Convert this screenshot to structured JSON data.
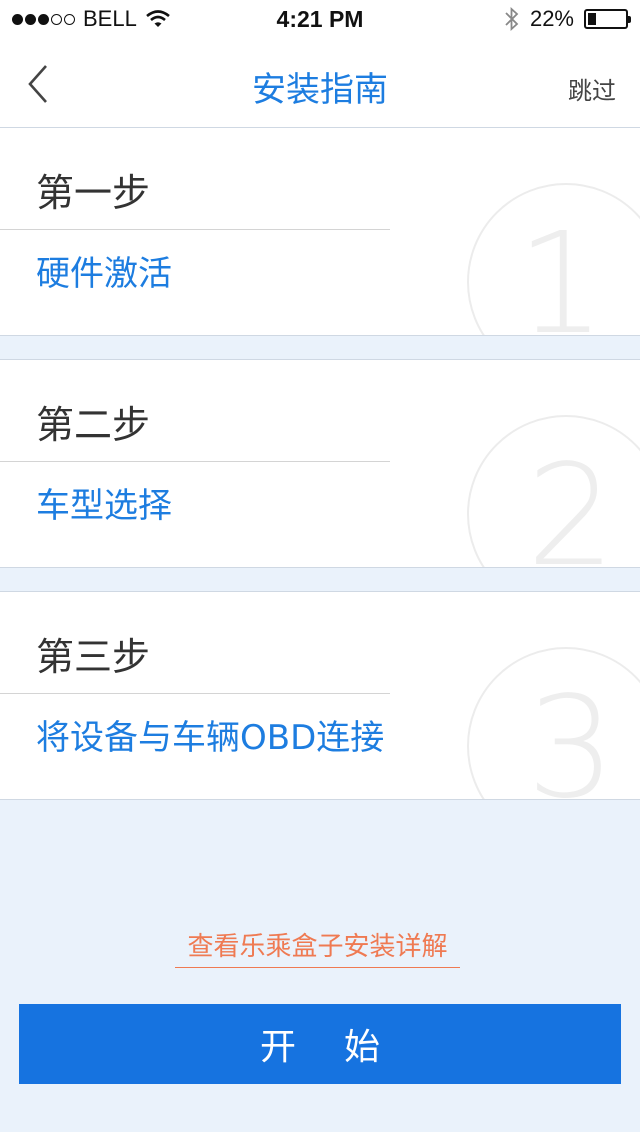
{
  "status_bar": {
    "carrier": "BELL",
    "time": "4:21 PM",
    "battery_percent_text": "22%",
    "battery_level": 0.22,
    "signal_bars": 3
  },
  "nav": {
    "title": "安装指南",
    "skip_label": "跳过"
  },
  "steps": [
    {
      "title": "第一步",
      "description": "硬件激活",
      "watermark_number": "1"
    },
    {
      "title": "第二步",
      "description": "车型选择",
      "watermark_number": "2"
    },
    {
      "title": "第三步",
      "description": "将设备与车辆OBD连接",
      "watermark_number": "3"
    }
  ],
  "detail_link": "查看乐乘盒子安装详解",
  "start_button": "开始",
  "colors": {
    "accent": "#1d7de0",
    "button_bg": "#1673e0",
    "link": "#ef7a52",
    "page_bg": "#eaf2fb"
  }
}
